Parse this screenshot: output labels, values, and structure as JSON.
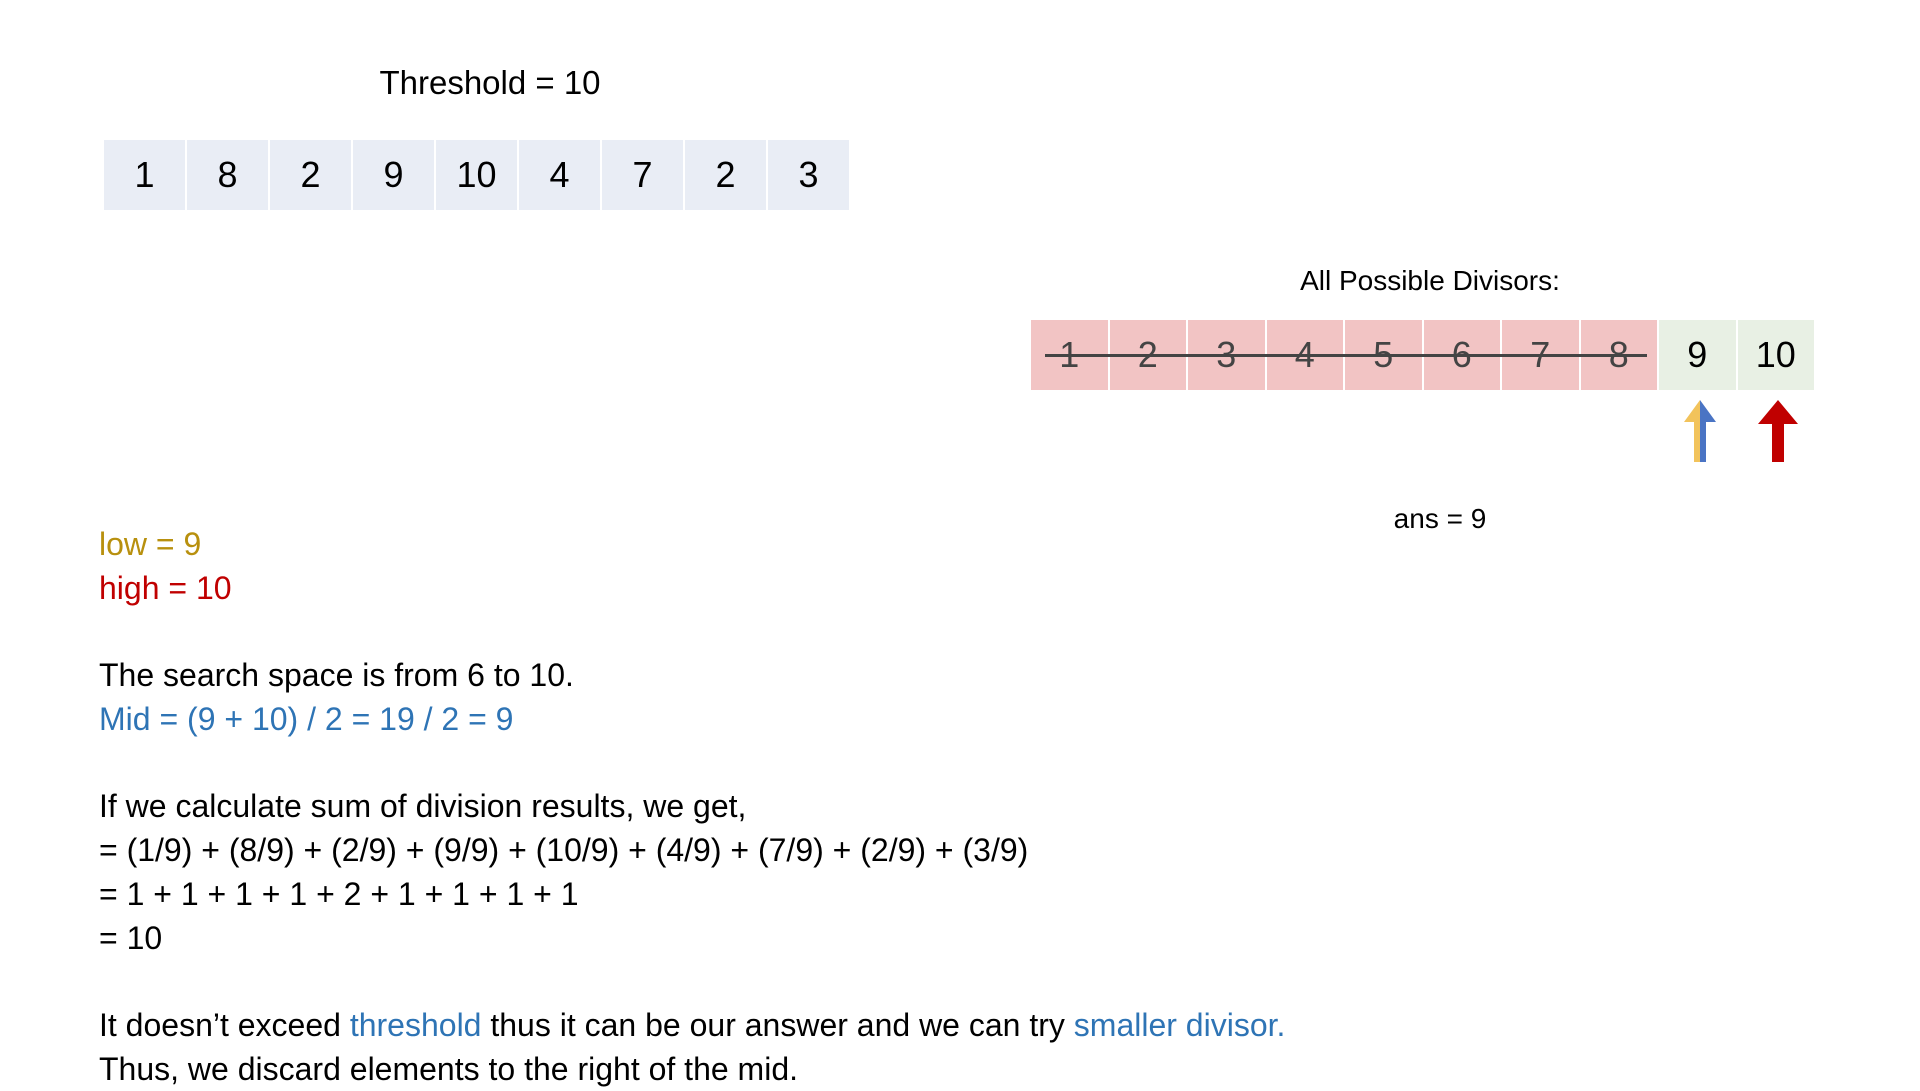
{
  "threshold_title": "Threshold = 10",
  "nums": [
    "1",
    "8",
    "2",
    "9",
    "10",
    "4",
    "7",
    "2",
    "3"
  ],
  "divisors": {
    "label": "All Possible Divisors:",
    "items": [
      {
        "value": "1",
        "state": "discarded"
      },
      {
        "value": "2",
        "state": "discarded"
      },
      {
        "value": "3",
        "state": "discarded"
      },
      {
        "value": "4",
        "state": "discarded"
      },
      {
        "value": "5",
        "state": "discarded"
      },
      {
        "value": "6",
        "state": "discarded"
      },
      {
        "value": "7",
        "state": "discarded"
      },
      {
        "value": "8",
        "state": "discarded"
      },
      {
        "value": "9",
        "state": "active"
      },
      {
        "value": "10",
        "state": "active"
      }
    ]
  },
  "pointers": {
    "low_pointer_index": 8,
    "high_pointer_index": 9
  },
  "ans_label": "ans = 9",
  "text": {
    "low": "low = 9",
    "high": "high = 10",
    "search_space": "The search space is from 6 to 10.",
    "mid": "Mid = (9 + 10) / 2 = 19 / 2 = 9",
    "calc_intro": "If we calculate sum of division results, we get,",
    "calc_line1": "= (1/9) + (8/9) + (2/9) + (9/9) + (10/9) + (4/9) + (7/9) + (2/9) + (3/9)",
    "calc_line2": "= 1 + 1 + 1 + 1 + 2 + 1 + 1 + 1 + 1",
    "calc_line3": "= 10",
    "conclusion_part1": "It doesn’t exceed ",
    "conclusion_threshold": "threshold",
    "conclusion_part2": " thus it can be our answer and we can try ",
    "conclusion_smaller": "smaller divisor.",
    "discard": "Thus, we discard elements to the right of the mid."
  },
  "colors": {
    "low": "#b8900e",
    "high": "#c00000",
    "highlight_blue": "#2e74b5",
    "array_cell": "#e9edf5",
    "discarded_cell": "#f2c4c4",
    "active_cell": "#e8f0e4",
    "low_arrow_yellow": "#f2c35b",
    "low_arrow_blue": "#4a74c4",
    "high_arrow": "#c00000"
  }
}
